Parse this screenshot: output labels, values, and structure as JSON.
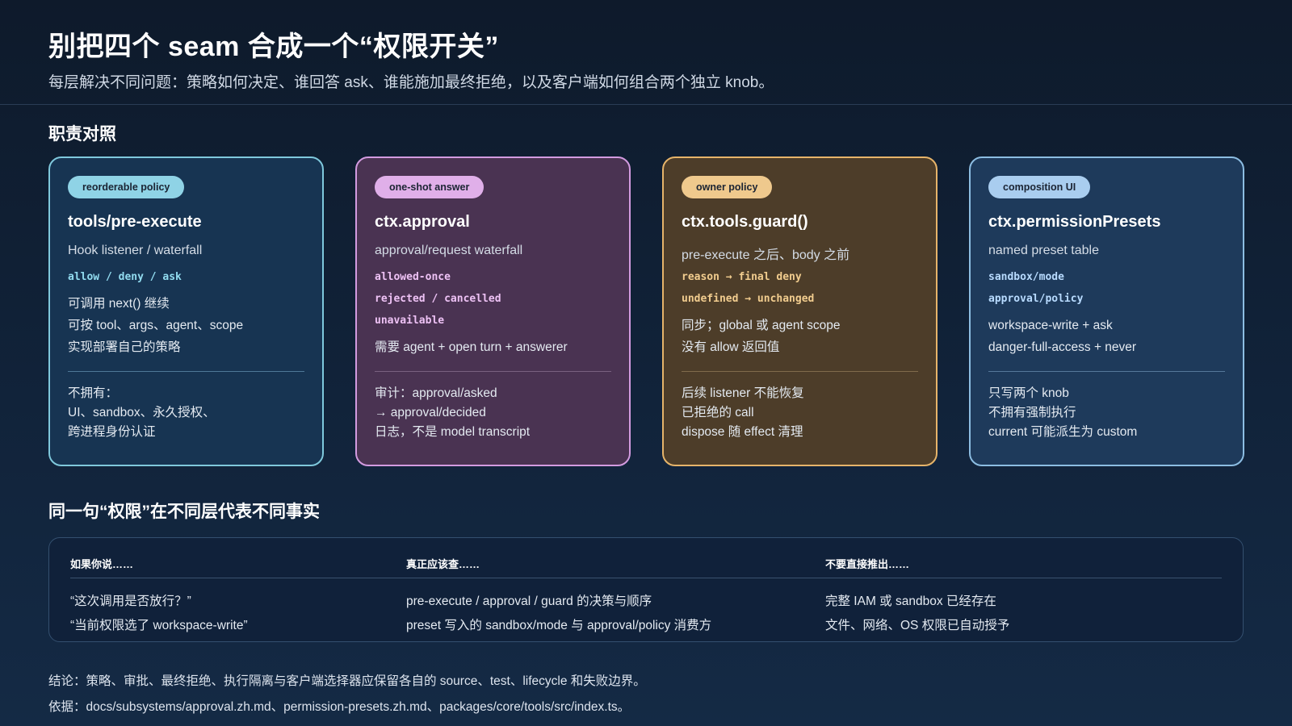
{
  "header": {
    "title": "别把四个 seam 合成一个“权限开关”",
    "subtitle": "每层解决不同问题：策略如何决定、谁回答 ask、谁能施加最终拒绝，以及客户端如何组合两个独立 knob。"
  },
  "section1": {
    "title": "职责对照"
  },
  "cards": [
    {
      "tag": "reorderable policy",
      "title": "tools/pre-execute",
      "desc": "Hook listener / waterfall",
      "codes": [
        "allow / deny / ask"
      ],
      "lines": [
        "可调用 next() 继续",
        "可按 tool、args、agent、scope",
        "实现部署自己的策略"
      ],
      "bottom": [
        "不拥有：",
        "UI、sandbox、永久授权、",
        "跨进程身份认证"
      ]
    },
    {
      "tag": "one-shot answer",
      "title": "ctx.approval",
      "desc": "approval/request waterfall",
      "codes": [
        "allowed-once",
        "rejected / cancelled",
        "unavailable"
      ],
      "lines": [
        "需要 agent + open turn + answerer"
      ],
      "bottom": [
        "审计：approval/asked",
        "→ approval/decided",
        "日志，不是 model transcript"
      ]
    },
    {
      "tag": "owner policy",
      "title": "ctx.tools.guard()",
      "desc": "pre-execute 之后、body 之前",
      "codes": [
        "reason → final deny",
        "undefined → unchanged"
      ],
      "lines": [
        "同步；global 或 agent scope",
        "没有 allow 返回值"
      ],
      "bottom": [
        "后续 listener 不能恢复",
        "已拒绝的 call",
        "dispose 随 effect 清理"
      ]
    },
    {
      "tag": "composition UI",
      "title": "ctx.permissionPresets",
      "desc": "named preset table",
      "codes": [
        "sandbox/mode",
        "approval/policy"
      ],
      "lines": [
        "workspace-write + ask",
        "danger-full-access + never"
      ],
      "bottom": [
        "只写两个 knob",
        "不拥有强制执行",
        "current 可能派生为 custom"
      ]
    }
  ],
  "section2": {
    "title": "同一句“权限”在不同层代表不同事实"
  },
  "table": {
    "headers": [
      "如果你说……",
      "真正应该查……",
      "不要直接推出……"
    ],
    "rows": [
      [
        "“这次调用是否放行？”",
        "pre-execute / approval / guard 的决策与顺序",
        "完整 IAM 或 sandbox 已经存在"
      ],
      [
        "“当前权限选了 workspace-write”",
        "preset 写入的 sandbox/mode 与 approval/policy 消费方",
        "文件、网络、OS 权限已自动授予"
      ]
    ]
  },
  "footer": {
    "conclusion": "结论：策略、审批、最终拒绝、执行隔离与客户端选择器应保留各自的 source、test、lifecycle 和失败边界。",
    "basis": "依据：docs/subsystems/approval.zh.md、permission-presets.zh.md、packages/core/tools/src/index.ts。"
  }
}
